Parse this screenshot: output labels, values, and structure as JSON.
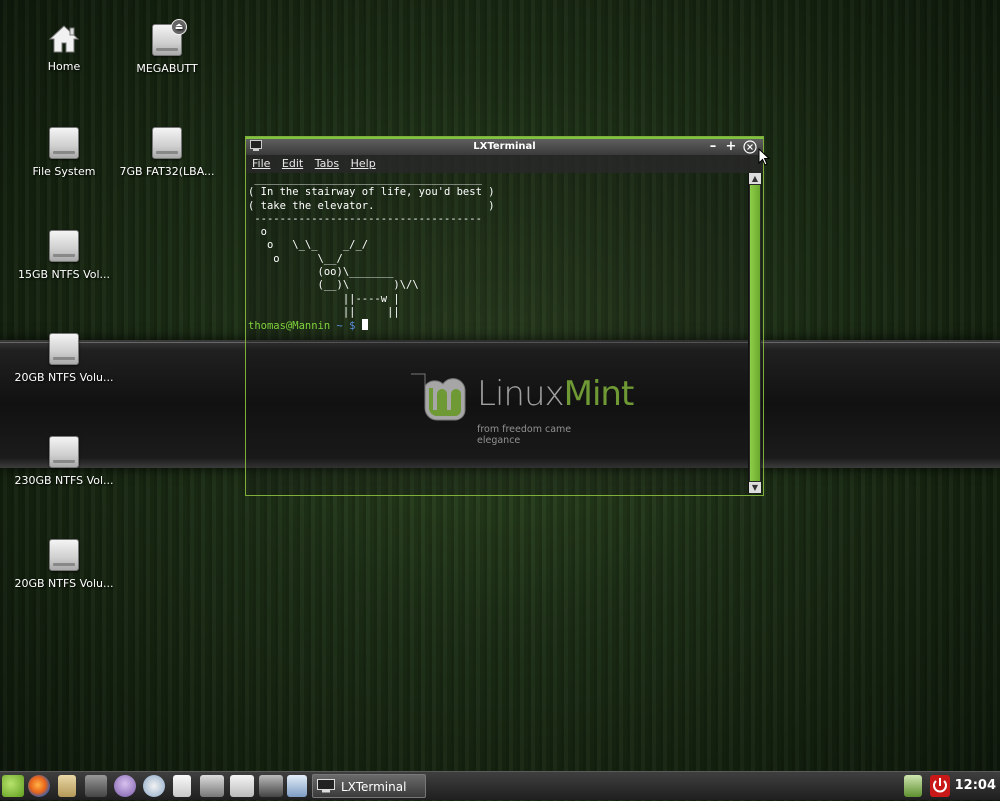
{
  "desktop": {
    "icons": [
      {
        "label": "Home"
      },
      {
        "label": "MEGABUTT"
      },
      {
        "label": "File System"
      },
      {
        "label": "7GB FAT32(LBA..."
      },
      {
        "label": "15GB NTFS Vol..."
      },
      {
        "label": "20GB NTFS Volu..."
      },
      {
        "label": "230GB NTFS Vol..."
      },
      {
        "label": "20GB NTFS Volu..."
      }
    ]
  },
  "terminal": {
    "title": "LXTerminal",
    "menu": [
      "File",
      "Edit",
      "Tabs",
      "Help"
    ],
    "output": " ____________________________________\n( In the stairway of life, you'd best )\n( take the elevator.                  )\n ------------------------------------\n  o\n   o   \\_\\_    _/_/\n    o      \\__/\n           (oo)\\_______\n           (__)\\       )\\/\\\n               ||----w |\n               ||     ||",
    "prompt_user": "thomas@Mannin",
    "prompt_dir": " ~ ",
    "prompt_symbol": "$"
  },
  "wallpaper": {
    "brand_linux": "Linux",
    "brand_mint": "Mint",
    "tagline": "from freedom came elegance"
  },
  "taskbar": {
    "task_label": "LXTerminal",
    "clock": "12:04"
  },
  "colors": {
    "accent": "#8cc63f",
    "prompt_user": "#7fd13b",
    "prompt_dollar": "#5b8fe0"
  }
}
